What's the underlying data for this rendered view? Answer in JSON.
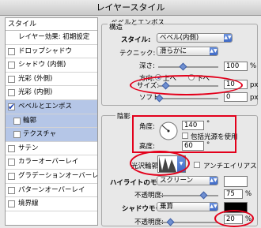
{
  "window": {
    "title": "レイヤースタイル"
  },
  "sidebar": {
    "header": "スタイル",
    "items": [
      {
        "label": "レイヤー効果: 初期設定",
        "checkbox": false
      },
      {
        "label": "ドロップシャドウ",
        "checkbox": true
      },
      {
        "label": "シャドウ (内側)",
        "checkbox": true
      },
      {
        "label": "光彩 (外側)",
        "checkbox": true
      },
      {
        "label": "光彩 (内側)",
        "checkbox": true
      },
      {
        "label": "ベベルとエンボス",
        "checkbox": true,
        "checked": true
      },
      {
        "label": "輪郭",
        "checkbox": true,
        "sub": true
      },
      {
        "label": "テクスチャ",
        "checkbox": true,
        "sub": true
      },
      {
        "label": "サテン",
        "checkbox": true
      },
      {
        "label": "カラーオーバーレイ",
        "checkbox": true
      },
      {
        "label": "グラデーションオーバーレイ",
        "checkbox": true
      },
      {
        "label": "パターンオーバーレイ",
        "checkbox": true
      },
      {
        "label": "境界線",
        "checkbox": true
      }
    ]
  },
  "bevel": {
    "section_title": "ベベルとエンボス",
    "structure_title": "構造",
    "style_label": "スタイル:",
    "style_value": "ベベル(内側)",
    "technique_label": "テクニック:",
    "technique_value": "滑らかに",
    "depth_label": "深さ:",
    "depth_value": "100",
    "depth_unit": "%",
    "direction_label": "方向:",
    "direction_up": "上へ",
    "direction_down": "下へ",
    "size_label": "サイズ:",
    "size_value": "10",
    "size_unit": "px",
    "soften_label": "ソフト:",
    "soften_value": "0",
    "soften_unit": "px"
  },
  "shading": {
    "section_title": "陰影",
    "angle_label": "角度:",
    "angle_value": "140",
    "angle_unit": "°",
    "global_light_label": "包括光源を使用",
    "altitude_label": "高度:",
    "altitude_value": "60",
    "altitude_unit": "°",
    "gloss_label": "光沢輪郭:",
    "antialias_label": "アンチエイリアス",
    "highlight_mode_label": "ハイライトのモード:",
    "highlight_mode_value": "スクリーン",
    "highlight_opacity_label": "不透明度:",
    "highlight_opacity_value": "75",
    "highlight_opacity_unit": "%",
    "shadow_mode_label": "シャドウモード:",
    "shadow_mode_value": "乗算",
    "shadow_opacity_label": "不透明度:",
    "shadow_opacity_value": "20",
    "shadow_opacity_unit": "%"
  },
  "colors": {
    "highlight_swatch": "#ffffff",
    "shadow_swatch": "#000000",
    "annotation": "#e3001b"
  }
}
